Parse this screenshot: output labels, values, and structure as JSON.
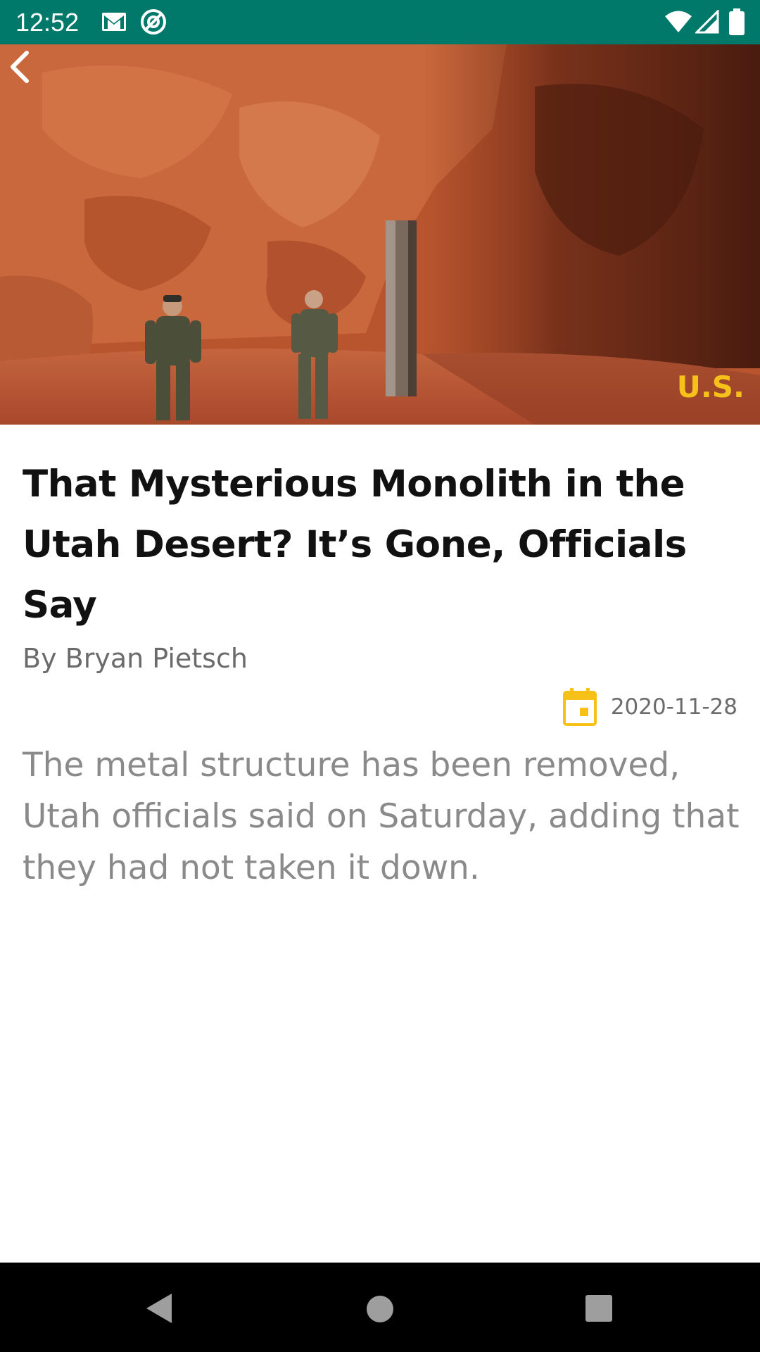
{
  "status_bar": {
    "time": "12:52",
    "icons": [
      "gmail-icon",
      "sync-icon",
      "wifi-icon",
      "signal-icon",
      "battery-icon"
    ]
  },
  "hero": {
    "category": "U.S.",
    "category_color": "#f6c21a",
    "image_subject": "monolith-desert-photo"
  },
  "article": {
    "headline": "That Mysterious Monolith in the Utah Desert? It’s Gone, Officials Say",
    "byline": "By Bryan Pietsch",
    "date": "2020-11-28",
    "description": "The metal structure has been removed, Utah officials said on Saturday, adding that they had not taken it down."
  },
  "colors": {
    "status_bar": "#00796b",
    "accent": "#f6c21a",
    "headline": "#111111",
    "muted_text": "#6b6b6b"
  },
  "nav_bar": {
    "buttons": [
      "back-nav-icon",
      "home-nav-icon",
      "recents-nav-icon"
    ]
  }
}
